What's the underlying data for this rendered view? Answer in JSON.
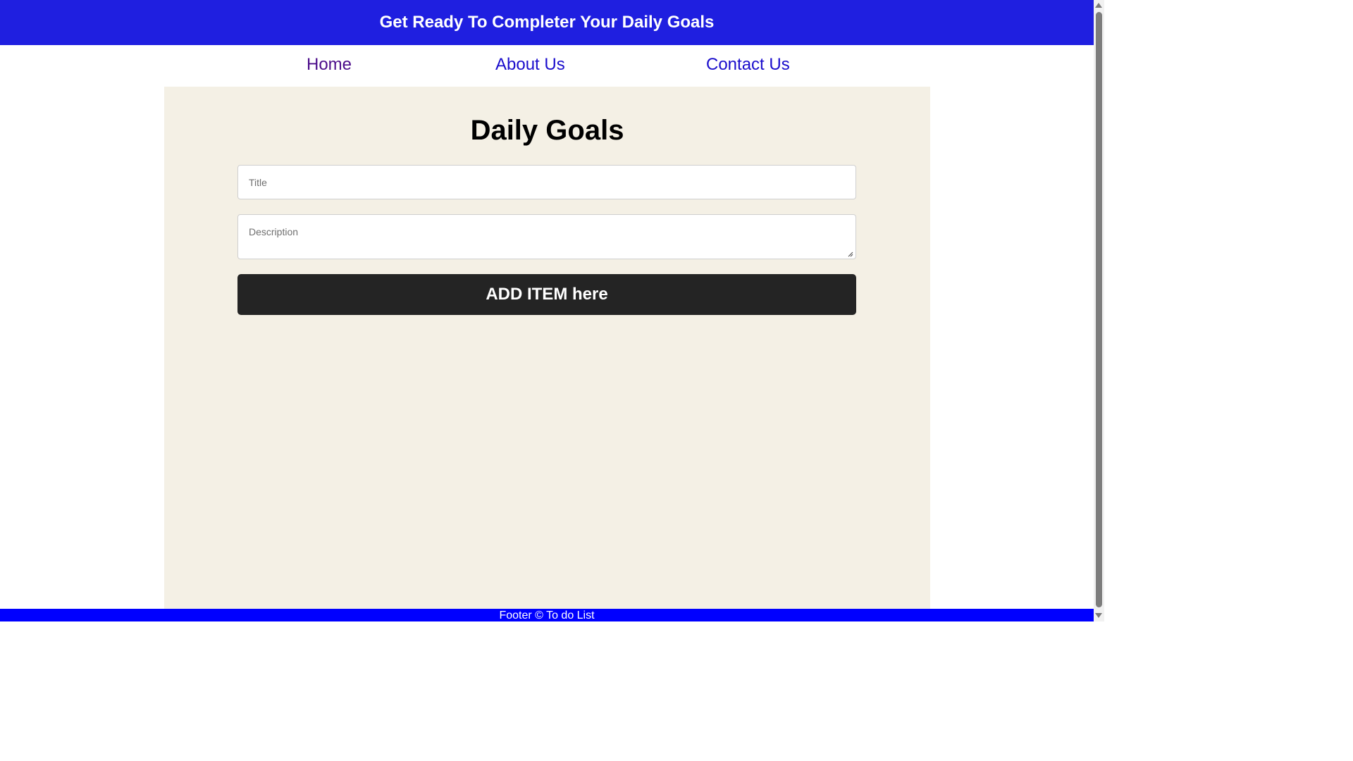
{
  "header": {
    "title": "Get Ready To Completer Your Daily Goals"
  },
  "nav": {
    "items": [
      {
        "label": "Home"
      },
      {
        "label": "About Us"
      },
      {
        "label": "Contact Us"
      }
    ]
  },
  "main": {
    "heading": "Daily Goals",
    "title_field": {
      "placeholder": "Title",
      "value": ""
    },
    "description_field": {
      "placeholder": "Description",
      "value": ""
    },
    "add_button": "ADD ITEM here"
  },
  "footer": {
    "text": "Footer © To do List"
  },
  "colors": {
    "header_bg": "#1f1fe0",
    "footer_bg": "#0000ff",
    "content_bg": "#f4f0e5",
    "button_bg": "#242424",
    "link": "#1a0dcc",
    "visited_link": "#4b0c8a"
  }
}
